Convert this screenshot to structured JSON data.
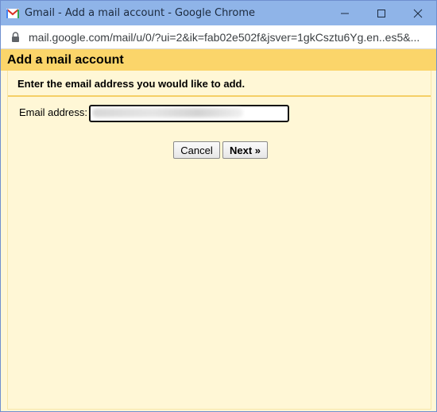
{
  "window": {
    "title": "Gmail - Add a mail account - Google Chrome",
    "minimize_symbol": "—",
    "maximize_symbol": "☐",
    "close_symbol": "✕"
  },
  "address_bar": {
    "url": "mail.google.com/mail/u/0/?ui=2&ik=fab02e502f&jsver=1gkCsztu6Yg.en..es5&..."
  },
  "dialog": {
    "title": "Add a mail account",
    "instruction": "Enter the email address you would like to add.",
    "email_label": "Email address:",
    "email_value": "",
    "cancel_label": "Cancel",
    "next_label": "Next »"
  },
  "colors": {
    "titlebar": "#8fb4e8",
    "header": "#fbd56a",
    "body": "#fff7d6"
  }
}
